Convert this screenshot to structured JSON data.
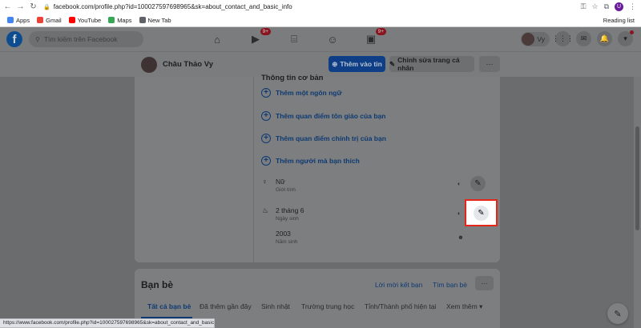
{
  "browser": {
    "url": "facebook.com/profile.php?id=100027597698965&sk=about_contact_and_basic_info",
    "bookmarks": [
      {
        "label": "Apps",
        "color": "#4285f4"
      },
      {
        "label": "Gmail",
        "color": "#ea4335"
      },
      {
        "label": "YouTube",
        "color": "#ff0000"
      },
      {
        "label": "Maps",
        "color": "#34a853"
      },
      {
        "label": "New Tab",
        "color": "#5f6368"
      }
    ],
    "reading_list": "Reading list",
    "profile_initial": "U",
    "status_url": "https://www.facebook.com/profile.php?id=100027597698965&sk=about_contact_and_basic..."
  },
  "header": {
    "logo": "f",
    "search_placeholder": "Tìm kiếm trên Facebook",
    "watch_badge": "9+",
    "gaming_badge": "9+",
    "user_short": "Vy"
  },
  "profile_bar": {
    "name": "Châu Thảo Vy",
    "add_story": "Thêm vào tin",
    "edit_profile": "Chỉnh sửa trang cá nhân",
    "more": "···"
  },
  "basic_info": {
    "section_title": "Thông tin cơ bản",
    "add_items": [
      "Thêm một ngôn ngữ",
      "Thêm quan điểm tôn giáo của bạn",
      "Thêm quan điểm chính trị của bạn",
      "Thêm người mà bạn thích"
    ],
    "gender": {
      "value": "Nữ",
      "label": "Giới tính"
    },
    "birthday": {
      "value": "2 tháng 6",
      "label": "Ngày sinh"
    },
    "birth_year": {
      "value": "2003",
      "label": "Năm sinh"
    }
  },
  "friends": {
    "title": "Bạn bè",
    "requests": "Lời mời kết bạn",
    "find": "Tìm bạn bè",
    "more": "···",
    "tabs": [
      "Tất cả bạn bè",
      "Đã thêm gần đây",
      "Sinh nhật",
      "Trường trung học",
      "Tỉnh/Thành phố hiện tại",
      "Xem thêm ▾"
    ]
  },
  "colors": {
    "accent": "#1877f2",
    "highlight_border": "#e4261a",
    "overlay_dim": "#6b6c6e"
  }
}
